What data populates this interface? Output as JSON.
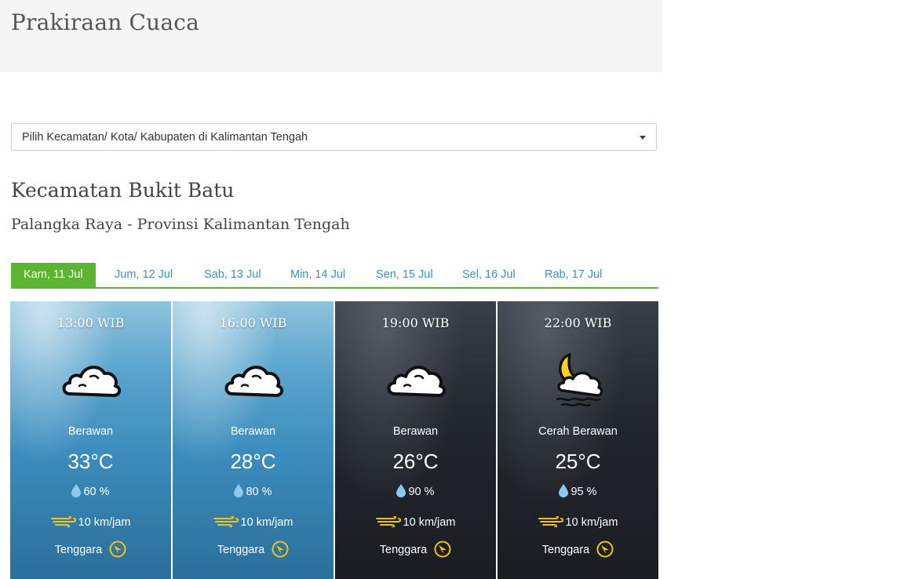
{
  "header": {
    "title": "Prakiraan Cuaca"
  },
  "location_select": {
    "value": "Pilih Kecamatan/ Kota/ Kabupaten di Kalimantan Tengah"
  },
  "location": {
    "title": "Kecamatan Bukit Batu",
    "subtitle": "Palangka Raya - Provinsi Kalimantan Tengah"
  },
  "tabs": [
    {
      "label": "Kam, 11 Jul",
      "active": true
    },
    {
      "label": "Jum, 12 Jul",
      "active": false
    },
    {
      "label": "Sab, 13 Jul",
      "active": false
    },
    {
      "label": "Min, 14 Jul",
      "active": false
    },
    {
      "label": "Sen, 15 Jul",
      "active": false
    },
    {
      "label": "Sel, 16 Jul",
      "active": false
    },
    {
      "label": "Rab, 17 Jul",
      "active": false
    }
  ],
  "forecasts": [
    {
      "time": "13:00 WIB",
      "condition": "Berawan",
      "temperature": "33°C",
      "humidity": "60 %",
      "wind_speed": "10 km/jam",
      "wind_direction": "Tenggara",
      "icon": "cloud-icon",
      "theme": "day"
    },
    {
      "time": "16:00 WIB",
      "condition": "Berawan",
      "temperature": "28°C",
      "humidity": "80 %",
      "wind_speed": "10 km/jam",
      "wind_direction": "Tenggara",
      "icon": "cloud-icon",
      "theme": "day"
    },
    {
      "time": "19:00 WIB",
      "condition": "Berawan",
      "temperature": "26°C",
      "humidity": "90 %",
      "wind_speed": "10 km/jam",
      "wind_direction": "Tenggara",
      "icon": "cloud-icon",
      "theme": "night"
    },
    {
      "time": "22:00 WIB",
      "condition": "Cerah Berawan",
      "temperature": "25°C",
      "humidity": "95 %",
      "wind_speed": "10 km/jam",
      "wind_direction": "Tenggara",
      "icon": "moon-cloud-icon",
      "theme": "night"
    }
  ],
  "colors": {
    "tab_active": "#5cb531",
    "tab_link": "#3a8fc7",
    "wind_icon": "#f2c21b",
    "humidity_icon": "#8cc8f2"
  }
}
